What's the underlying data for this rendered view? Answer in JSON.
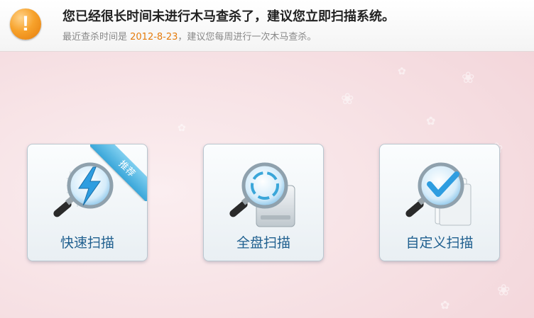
{
  "banner": {
    "icon": "warning-icon",
    "icon_glyph": "!",
    "title": "您已经很长时间未进行木马查杀了，建议您立即扫描系统。",
    "subtitle_prefix": "最近查杀时间是 ",
    "last_scan_date": "2012-8-23",
    "subtitle_suffix": "，建议您每周进行一次木马查杀。",
    "colors": {
      "date": "#e57c0c",
      "warning": "#f7a22b"
    }
  },
  "scan_options": [
    {
      "label": "快速扫描",
      "icon": "quick-scan-icon",
      "badge": "推荐"
    },
    {
      "label": "全盘扫描",
      "icon": "full-disk-scan-icon"
    },
    {
      "label": "自定义扫描",
      "icon": "custom-scan-icon"
    }
  ]
}
